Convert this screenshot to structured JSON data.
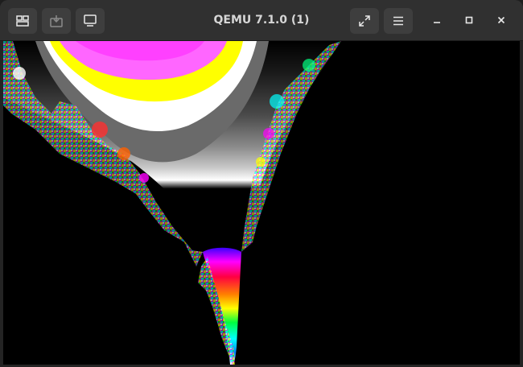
{
  "window": {
    "title": "QEMU 7.1.0 (1)"
  },
  "toolbar": {
    "left_buttons": [
      {
        "icon": "tabs-overview-icon",
        "enabled": true
      },
      {
        "icon": "send-keys-icon",
        "enabled": false
      },
      {
        "icon": "display-monitor-icon",
        "enabled": true
      }
    ],
    "right_buttons": [
      {
        "icon": "fullscreen-icon",
        "enabled": true
      },
      {
        "icon": "hamburger-menu-icon",
        "enabled": true
      }
    ],
    "window_controls": [
      "minimize-icon",
      "maximize-icon",
      "close-icon"
    ]
  },
  "display": {
    "content": "mandelbrot-fractal",
    "background_color": "#000000"
  },
  "colors": {
    "titlebar": "#303030",
    "button": "#3e3e3e",
    "title_text": "#d6d6d6",
    "icon": "#e8e8e8"
  }
}
